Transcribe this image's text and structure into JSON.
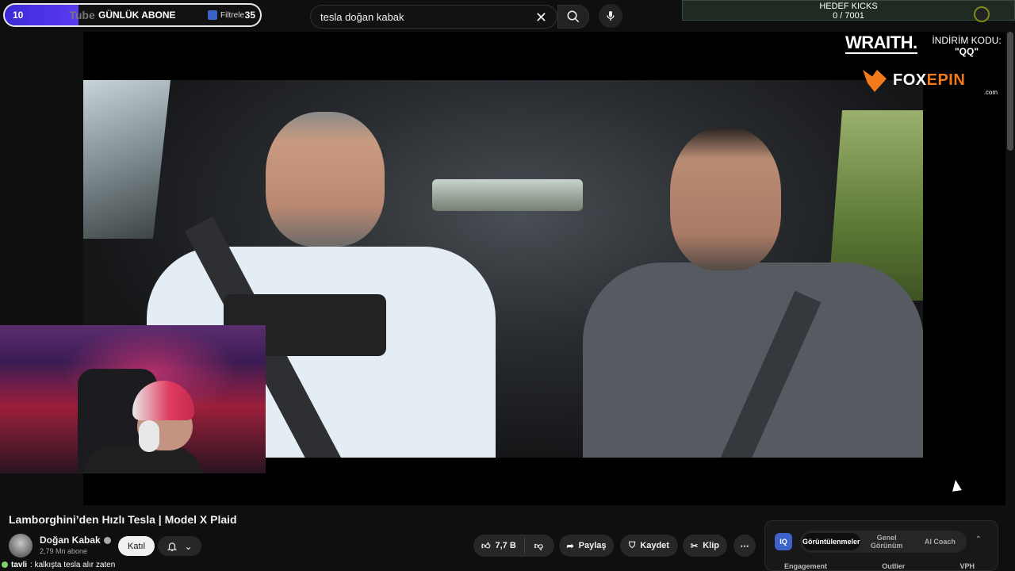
{
  "overlay": {
    "subscriber_goal": {
      "current": "10",
      "youtube_logo_text": "Tube",
      "label": "GÜNLÜK ABONE",
      "filter_label": "Filtrele",
      "target": "35",
      "progress_fraction": 0.29
    },
    "kicks_goal": {
      "title": "HEDEF KICKS",
      "value": "0 / 7001"
    },
    "sponsors": {
      "wraith_logo": "WRAITH.",
      "promo_label": "İNDİRİM KODU:",
      "promo_code": "\"QQ\"",
      "foxepin_logo_fox": "FOX",
      "foxepin_logo_epin": "EPIN",
      "foxepin_suffix": ".com"
    }
  },
  "search": {
    "value": "tesla doğan kabak",
    "clear_icon": "close-icon",
    "search_icon": "search-icon",
    "mic_icon": "mic-icon"
  },
  "video": {
    "title": "Lamborghini’den Hızlı Tesla | Model X Plaid",
    "channel": {
      "name": "Doğan Kabak",
      "subscribers": "2,79 Mn abone",
      "join_label": "Katıl",
      "bell_icon": "bell-icon"
    },
    "actions": {
      "like_count": "7,7 B",
      "share_label": "Paylaş",
      "save_label": "Kaydet",
      "clip_label": "Klip",
      "more_icon": "more-icon"
    }
  },
  "chat": {
    "user": "tavli",
    "message": ": kalkışta tesla alır zaten"
  },
  "analytics_panel": {
    "logo": "IQ",
    "tabs": [
      "Görüntülenmeler",
      "Genel Görünüm",
      "AI Coach"
    ],
    "active_tab": 0,
    "columns": [
      "Engagement",
      "Outlier",
      "VPH"
    ]
  },
  "colors": {
    "background": "#0f0f0f",
    "accent_purple": "#4b34e6",
    "foxepin_orange": "#f27a1a",
    "goal_bar": "#1f2b22"
  }
}
